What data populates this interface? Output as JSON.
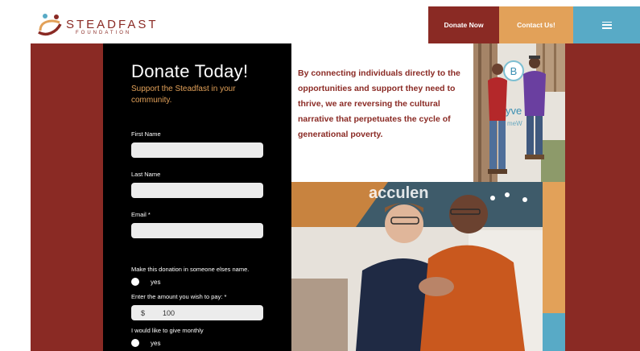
{
  "header": {
    "logo": {
      "name": "STEADFAST",
      "sub": "FOUNDATION"
    },
    "nav": {
      "donate_label": "Donate Now",
      "contact_label": "Contact Us!",
      "menu_icon": "hamburger-icon"
    }
  },
  "form": {
    "title": "Donate Today!",
    "subtitle": "Support the Steadfast in your community.",
    "first_name_label": "First Name",
    "first_name_value": "",
    "last_name_label": "Last Name",
    "last_name_value": "",
    "email_label": "Email *",
    "email_value": "",
    "honor_question": "Make this donation in someone elses name.",
    "honor_option": "yes",
    "amount_label": "Enter the amount you wish to pay: *",
    "amount_currency": "$",
    "amount_value": "100",
    "monthly_question": "I would like to give monthly",
    "monthly_option": "yes"
  },
  "mission": {
    "text": "By connecting individuals directly to the opportunities and support they need to thrive, we are reversing the cultural narrative that perpetuates the cycle of generational poverty."
  },
  "photos": {
    "top_sign_letter": "B",
    "top_sign_text": "yve",
    "top_sign_sub": "meW",
    "bottom_banner": "acculen"
  },
  "colors": {
    "brand_red": "#8a2a24",
    "accent_orange": "#e2a159",
    "accent_blue": "#58aac6",
    "form_bg": "#000000"
  }
}
